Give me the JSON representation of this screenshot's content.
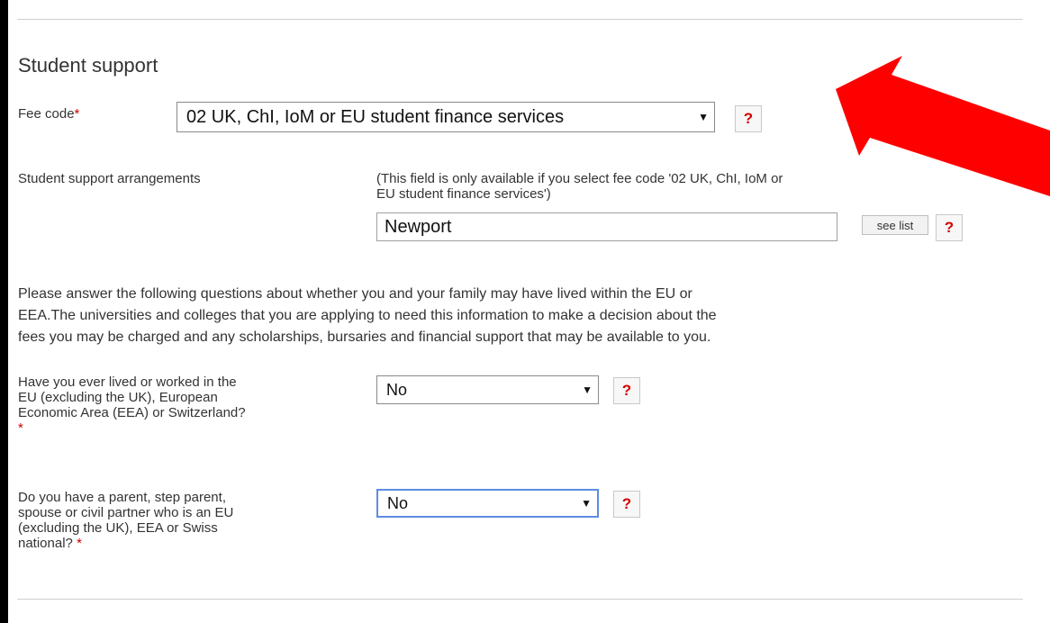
{
  "section": {
    "title": "Student support"
  },
  "fee_code": {
    "label": "Fee code",
    "required_mark": "*",
    "selected": "02 UK, ChI, IoM or EU student finance services",
    "help": "?"
  },
  "support_arrangements": {
    "label": "Student support arrangements",
    "note_line1": "(This field is only available if you select fee code '02 UK, ChI, IoM or",
    "note_line2": "EU student finance services')",
    "value": "Newport",
    "see_list": "see list",
    "help": "?"
  },
  "intro": {
    "line1": "Please answer the following questions about whether you and your family may have lived within the EU or",
    "line2": "EEA.The universities and colleges that you are applying to need this information to make a decision about the",
    "line3": "fees you may be charged and any scholarships, bursaries and financial support that may be available to you."
  },
  "q_lived": {
    "line1": "Have you ever lived or worked in the",
    "line2": "EU (excluding the UK), European",
    "line3": "Economic Area (EEA) or Switzerland?",
    "required_mark": "*",
    "selected": "No",
    "help": "?"
  },
  "q_parent": {
    "line1": "Do you have a parent, step parent,",
    "line2": "spouse or civil partner who is an EU",
    "line3": "(excluding the UK), EEA or Swiss",
    "line4": "national?",
    "required_mark": "*",
    "selected": "No",
    "help": "?"
  },
  "colors": {
    "annotation_arrow": "#ff0000",
    "help_mark": "#d60000",
    "focus_border": "#5b8de0"
  },
  "icons": {
    "dropdown": "triangle-down-icon",
    "annotation": "red-arrow-icon"
  }
}
